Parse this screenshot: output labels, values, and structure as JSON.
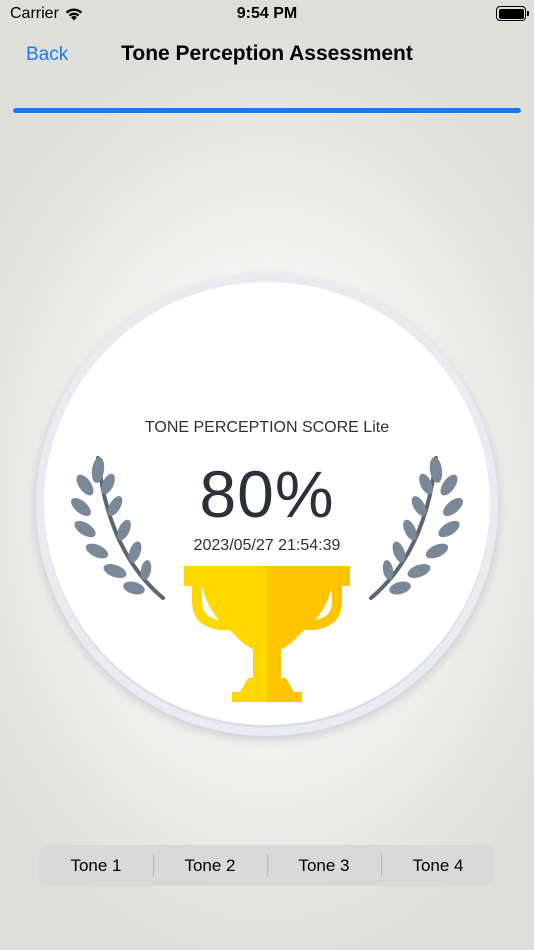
{
  "status_bar": {
    "carrier": "Carrier",
    "time": "9:54 PM",
    "wifi_icon": "wifi-icon",
    "battery_icon": "battery-icon"
  },
  "nav": {
    "back_label": "Back",
    "title": "Tone Perception Assessment"
  },
  "progress": {
    "fraction": 1.0,
    "color": "#1a7bf0"
  },
  "result": {
    "label": "TONE PERCEPTION SCORE Lite",
    "score": "80%",
    "timestamp": "2023/05/27 21:54:39",
    "laurel_icon": "laurel-icon",
    "trophy_icon": "trophy-icon"
  },
  "tones": [
    {
      "label": "Tone 1"
    },
    {
      "label": "Tone 2"
    },
    {
      "label": "Tone 3"
    },
    {
      "label": "Tone 4"
    }
  ],
  "colors": {
    "accent": "#1a7bf0",
    "trophy_light": "#ffd800",
    "trophy_dark": "#ffc400",
    "laurel": "#7b8898"
  }
}
